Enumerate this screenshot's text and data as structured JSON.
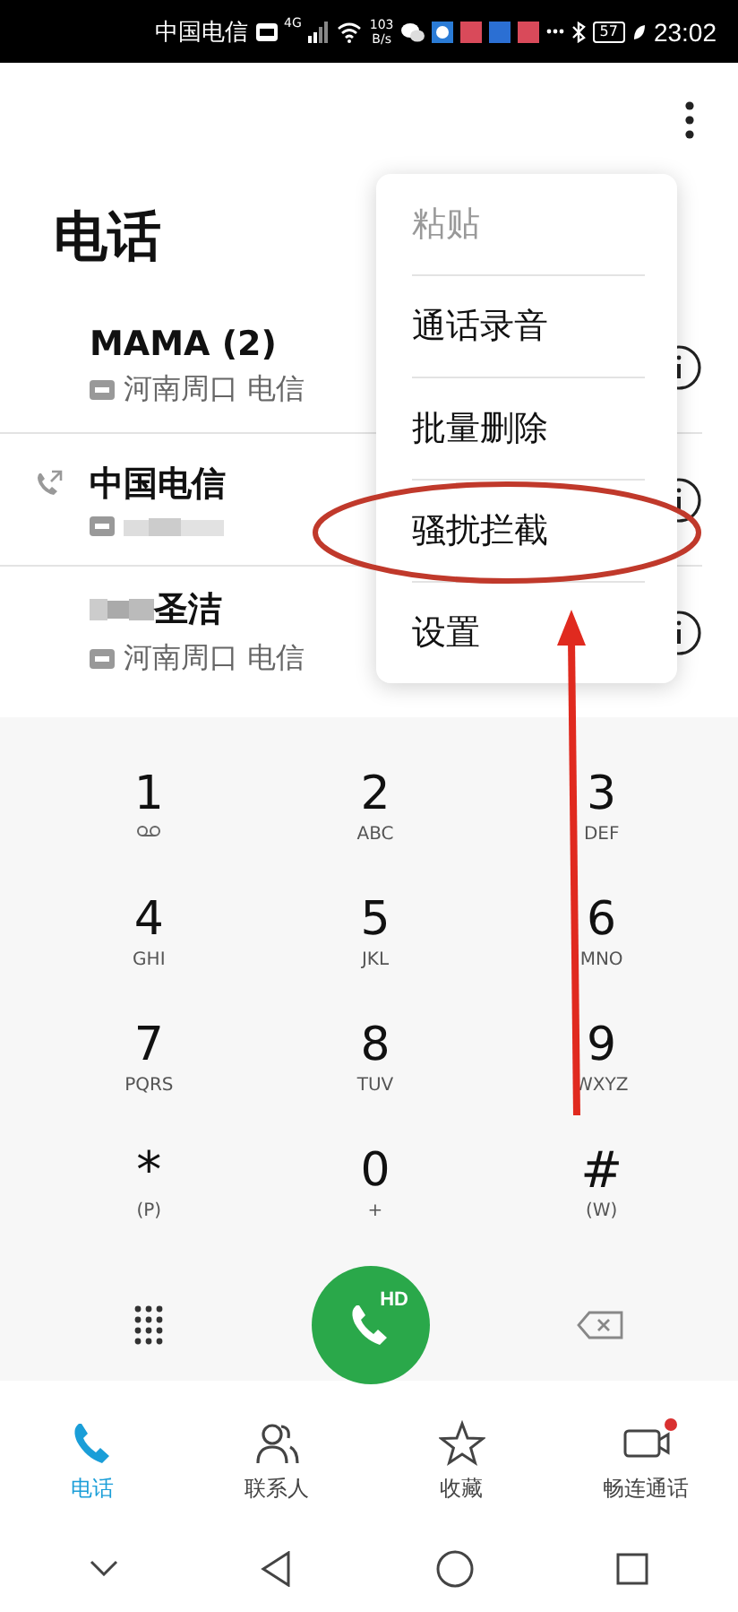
{
  "status_bar": {
    "carrier": "中国电信",
    "network": "4G",
    "speed": [
      "103",
      "B/s"
    ],
    "battery": "57",
    "time": "23:02"
  },
  "title": "电话",
  "calls": [
    {
      "name": "MAMA (2)",
      "location": "河南周口 电信",
      "outgoing": false,
      "blurred": false
    },
    {
      "name": "中国电信",
      "outgoing": true,
      "blurred": true
    },
    {
      "name": "圣洁",
      "location": "河南周口 电信",
      "outgoing": false,
      "blurred": true
    }
  ],
  "menu": [
    {
      "label": "粘贴",
      "disabled": true
    },
    {
      "label": "通话录音",
      "disabled": false
    },
    {
      "label": "批量删除",
      "disabled": false
    },
    {
      "label": "骚扰拦截",
      "disabled": false
    },
    {
      "label": "设置",
      "disabled": false
    }
  ],
  "keys": [
    {
      "digit": "1",
      "kind": "voicemail"
    },
    {
      "digit": "2",
      "letters": "ABC",
      "kind": "digit"
    },
    {
      "digit": "3",
      "letters": "DEF",
      "kind": "digit"
    },
    {
      "digit": "4",
      "letters": "GHI",
      "kind": "digit"
    },
    {
      "digit": "5",
      "letters": "JKL",
      "kind": "digit"
    },
    {
      "digit": "6",
      "letters": "MNO",
      "kind": "digit"
    },
    {
      "digit": "7",
      "letters": "PQRS",
      "kind": "digit"
    },
    {
      "digit": "8",
      "letters": "TUV",
      "kind": "digit"
    },
    {
      "digit": "9",
      "letters": "WXYZ",
      "kind": "digit"
    },
    {
      "digit": "*",
      "letters": "(P)",
      "kind": "symbol"
    },
    {
      "digit": "0",
      "letters": "+",
      "kind": "digit"
    },
    {
      "digit": "#",
      "letters": "(W)",
      "kind": "symbol"
    }
  ],
  "call_button": "HD",
  "tabs": [
    {
      "label": "电话",
      "selected": true,
      "badge": false
    },
    {
      "label": "联系人",
      "selected": false,
      "badge": false
    },
    {
      "label": "收藏",
      "selected": false,
      "badge": false
    },
    {
      "label": "畅连通话",
      "selected": false,
      "badge": true
    }
  ]
}
